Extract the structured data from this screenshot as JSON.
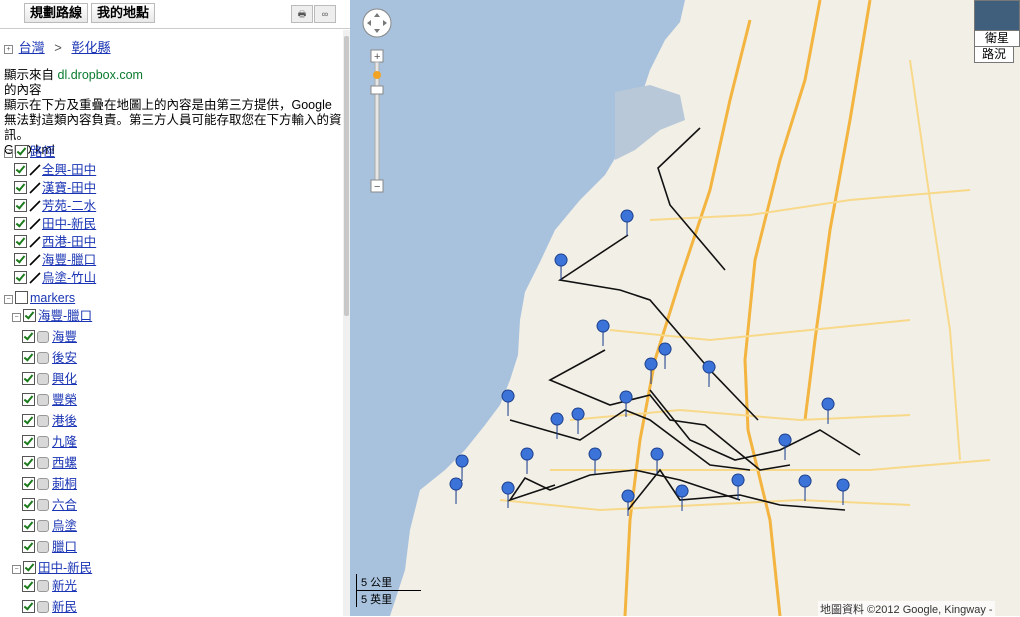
{
  "header": {
    "directions_label": "規劃路線",
    "mymaps_label": "我的地點",
    "print_label": "🖶",
    "link_label": "∞"
  },
  "breadcrumb": {
    "root": "台灣",
    "sep": ">",
    "current": "彰化縣"
  },
  "info": {
    "line1_prefix": "顯示來自",
    "source": "dl.dropbox.com",
    "line2": "的內容",
    "disclaimer": "顯示在下方及重疊在地圖上的內容是由第三方提供，Google 無法對這類內容負責。第三方人員可能存取您在下方輸入的資訊。",
    "file": "GEO.kml"
  },
  "tree": {
    "paths_label": "路徑",
    "paths": [
      "全興-田中",
      "漢寶-田中",
      "芳苑-二水",
      "田中-新民",
      "西港-田中",
      "海豐-臘口",
      "烏塗-竹山"
    ],
    "markers_label": "markers",
    "group1": {
      "label": "海豐-臘口",
      "items": [
        "海豐",
        "後安",
        "興化",
        "豐榮",
        "港後",
        "九隆",
        "西螺",
        "莿桐",
        "六合",
        "烏塗",
        "臘口"
      ]
    },
    "group2": {
      "label": "田中-新民",
      "items": [
        "新光",
        "新民"
      ]
    }
  },
  "map": {
    "satellite_label": "衛星",
    "traffic_label": "路況",
    "scale_km": "5 公里",
    "scale_mi": "5 英里",
    "attribution": "地圖資料 ©2012 Google, Kingway -",
    "colors": {
      "land": "#f3efe4",
      "sea": "#a7c1dc",
      "route": "#111111",
      "pin": "#3a72d6"
    }
  }
}
